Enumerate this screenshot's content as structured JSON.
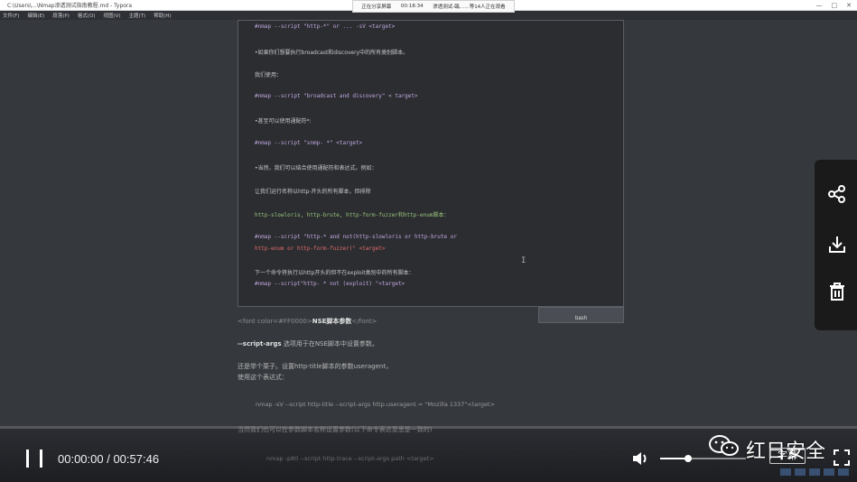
{
  "window": {
    "title": "C:\\Users\\...\\Nmap渗透测试指南教程.md - Typora",
    "controls": [
      "—",
      "□",
      "✕"
    ]
  },
  "menu": [
    "文件(F)",
    "编辑(E)",
    "段落(P)",
    "格式(O)",
    "视图(V)",
    "主题(T)",
    "帮助(H)"
  ],
  "recording": {
    "status": "正在分享屏幕",
    "elapsed": "00:18:34",
    "meeting": "渗透测试-臨……等14人正在观看"
  },
  "code": [
    {
      "text": "#nmap --script \"http-*\" or ... -sV <target>",
      "style": "cmd"
    },
    {
      "text": "•如果你们想要执行broadcast和discovery中的所有类别脚本。",
      "style": "txt"
    },
    {
      "text": "我们使用：",
      "style": "txt"
    },
    {
      "text": "#nmap --script \"broadcast and discovery\" < target>",
      "style": "cmd"
    },
    {
      "text": "•甚至可以使用通配符*:",
      "style": "txt"
    },
    {
      "text": "#nmap --script \"snmp- *\" <target>",
      "style": "cmd"
    },
    {
      "text": "•当然，我们可以结合使用通配符和表达式。例如：",
      "style": "txt"
    },
    {
      "text": "让我们运行名称以http-开头的所有脚本，但排除",
      "style": "txt"
    },
    {
      "text": "http-slowloris, http-brute, http-form-fuzzer和http-enum脚本：",
      "style": "grn"
    },
    {
      "text": "#nmap --script \"http-* and not(http-slowloris or http-brute or",
      "style": "cmd"
    },
    {
      "text": "http-enum or http-form-fuzzer)\" <target>",
      "style": "str"
    },
    {
      "text": "下一个命令将执行以http开头的但不在exploit类别中的所有脚本：",
      "style": "txt"
    },
    {
      "text": "#nmap --script\"http- * not (exploit) \"<target>",
      "style": "cmd"
    }
  ],
  "code_lang": "bash",
  "doc": {
    "heading_pre": "<font color=#FF0000>",
    "heading": "NSE脚本参数",
    "heading_post": "</font>",
    "arg_label": "--script-args",
    "arg_text": " 选项用于在NSE脚本中设置参数。",
    "example1": "还是举个栗子。设置http-title脚本的参数useragent，",
    "example2": "使用这个表达式：",
    "cmd1": "nmap -sV --script http-title --script-args http.useragent = \"Mozilla 1337\"<target>",
    "overlay": "当然我们也可以在参数脚本名称设置参数(以下命令表达意思是一致的)",
    "cmd2": "nmap -p80 --script http-trace --script-args path <target>"
  },
  "player": {
    "current_time": "00:00:00",
    "separator": " / ",
    "duration": "00:57:46",
    "progress": 0.0,
    "volume": 0.33,
    "subtitle_label": "字幕",
    "brand": "红日安全"
  },
  "rail": {
    "icons": [
      "share-icon",
      "download-icon",
      "delete-icon"
    ]
  }
}
